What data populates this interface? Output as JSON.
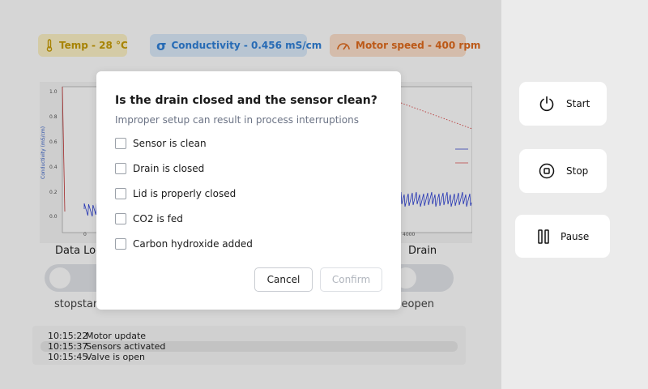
{
  "sensors": {
    "temp": "Temp - 28 °C",
    "conductivity": "Conductivity - 0.456 mS/cm",
    "motor": "Motor speed - 400 rpm"
  },
  "chart": {
    "ylabel": "Conductivity (mS/cm)",
    "yticks": [
      "1.0",
      "0.8",
      "0.6",
      "0.4",
      "0.2",
      "0.0"
    ],
    "xticks": [
      "0",
      "4000"
    ]
  },
  "sections": {
    "data_log_label": "Data Log",
    "drain_label": "Drain"
  },
  "toggles": {
    "left_label": "stopstart",
    "right_label": "closeopen"
  },
  "log": [
    {
      "time": "10:15:22",
      "msg": "Motor update"
    },
    {
      "time": "10:15:37",
      "msg": "Sensors activated"
    },
    {
      "time": "10:15:45",
      "msg": "Valve is open"
    }
  ],
  "controls": {
    "start": "Start",
    "stop": "Stop",
    "pause": "Pause"
  },
  "modal": {
    "title": "Is the drain closed and the sensor clean?",
    "subtitle": "Improper setup can result in process interruptions",
    "checks": [
      {
        "label": "Sensor is clean",
        "checked": false
      },
      {
        "label": "Drain is closed",
        "checked": false
      },
      {
        "label": "Lid is properly closed",
        "checked": false
      },
      {
        "label": "CO2 is fed",
        "checked": false
      },
      {
        "label": "Carbon hydroxide added",
        "checked": false
      }
    ],
    "cancel": "Cancel",
    "confirm": "Confirm"
  },
  "colors": {
    "temp": "#c79c05",
    "conductivity": "#2f80d8",
    "motor": "#e06b1d",
    "series_blue": "#2b3fd6",
    "series_red": "#e05a5a"
  }
}
